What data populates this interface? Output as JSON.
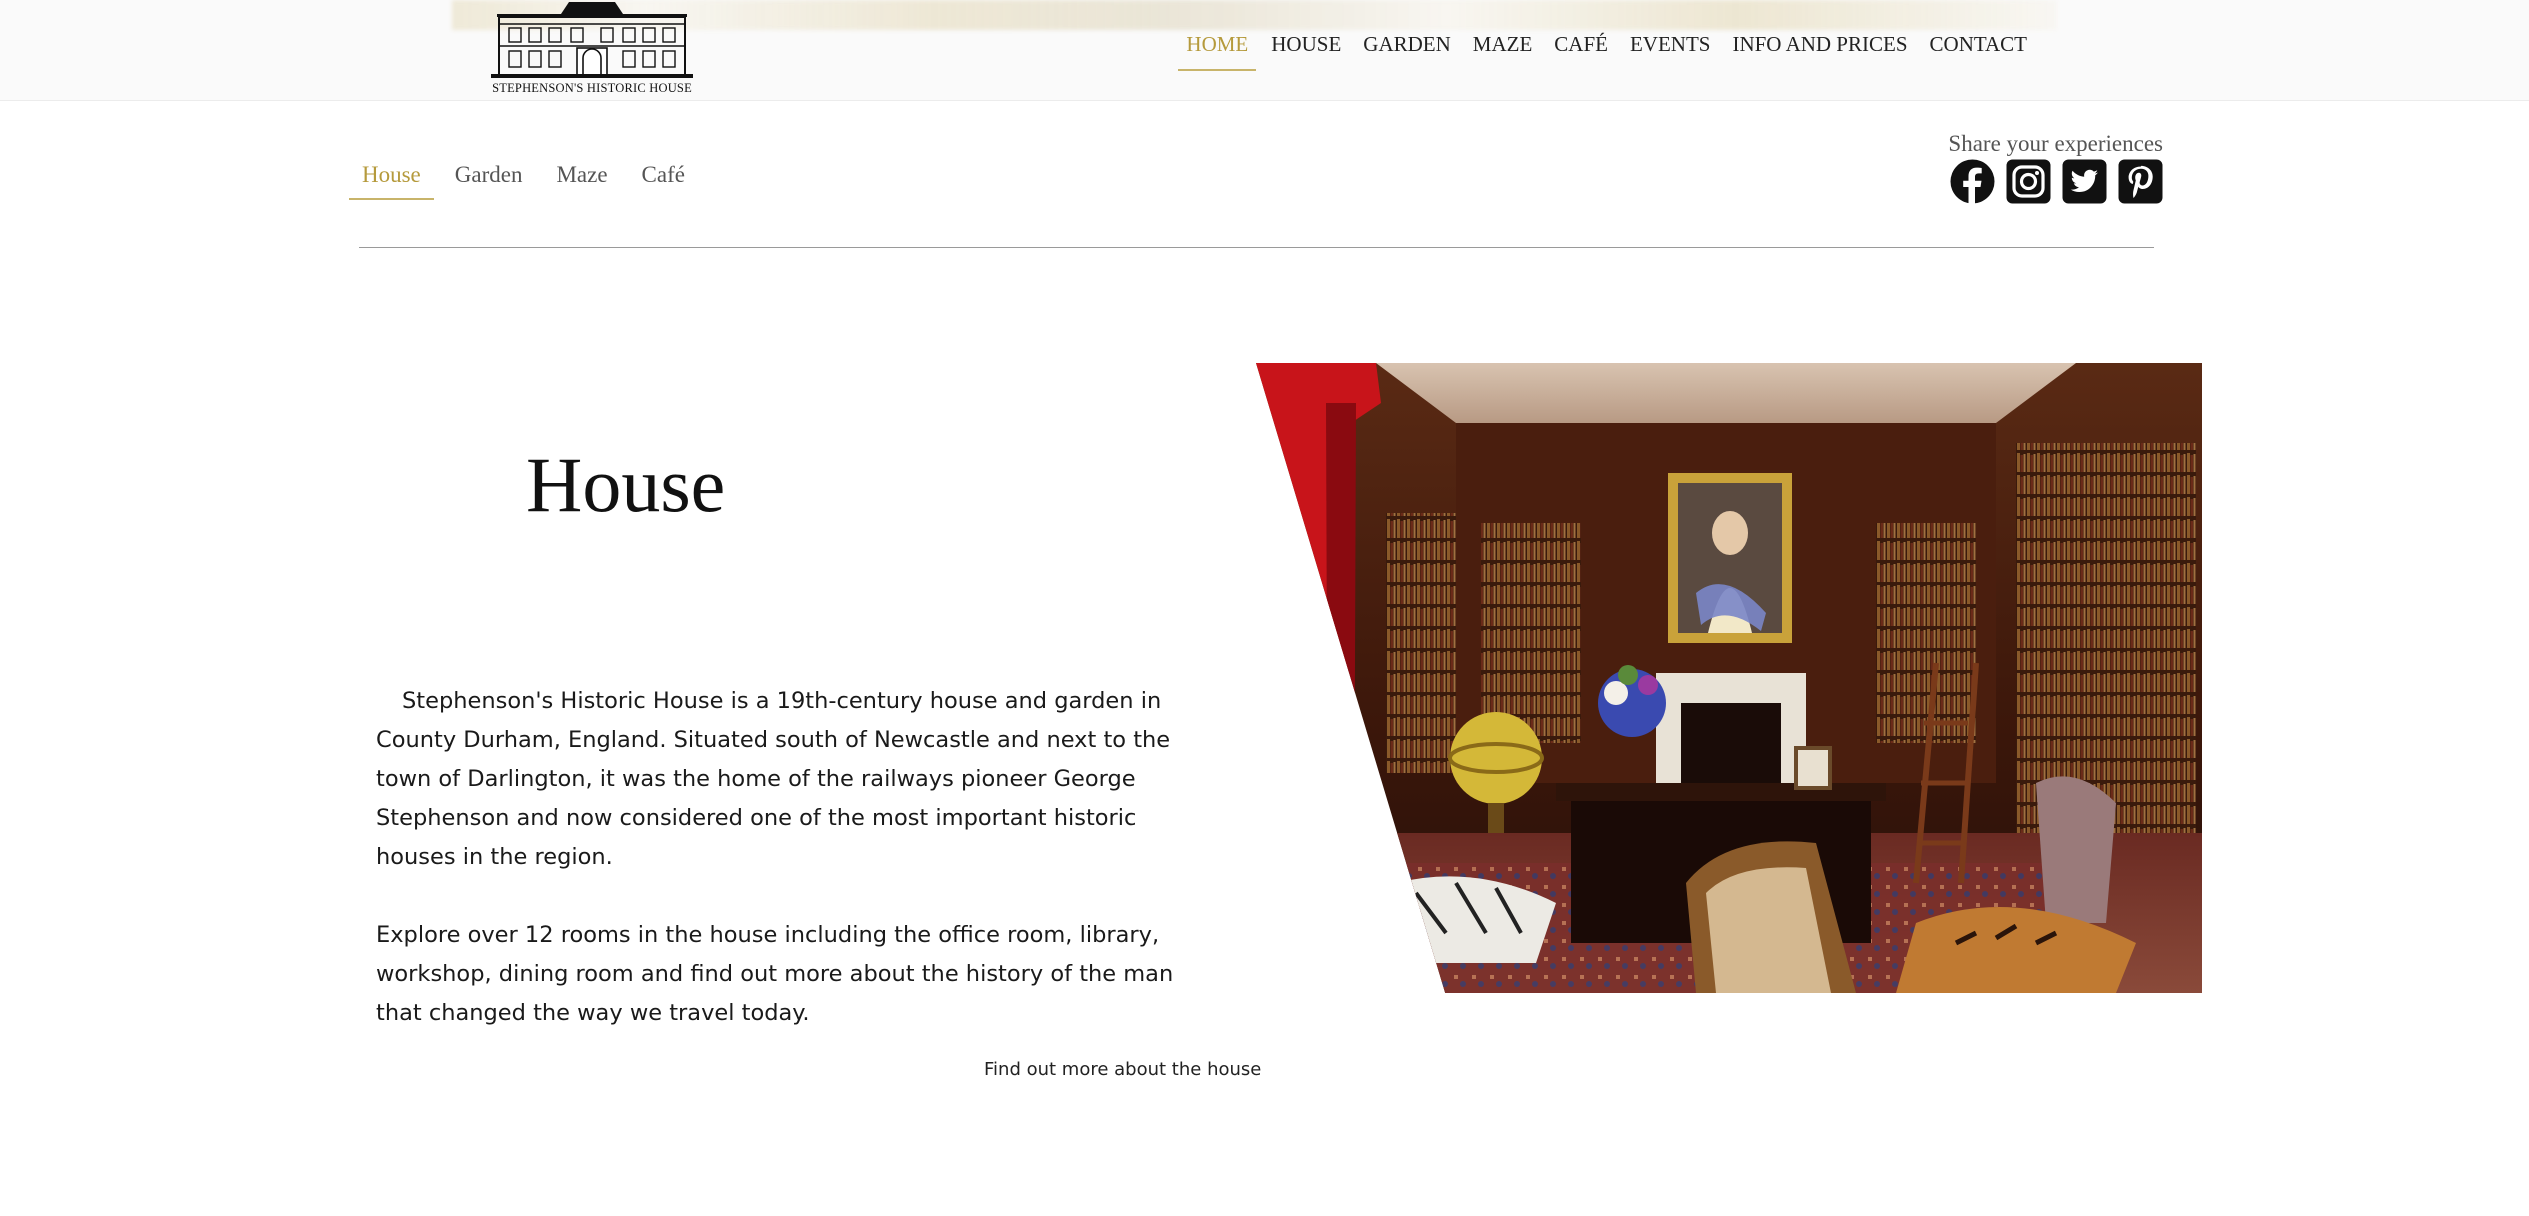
{
  "brand": {
    "logo_text": "STEPHENSON'S HISTORIC HOUSE"
  },
  "main_nav": {
    "items": [
      {
        "label": "HOME",
        "active": true
      },
      {
        "label": "HOUSE",
        "active": false
      },
      {
        "label": "GARDEN",
        "active": false
      },
      {
        "label": "MAZE",
        "active": false
      },
      {
        "label": "CAFÉ",
        "active": false
      },
      {
        "label": "EVENTS",
        "active": false
      },
      {
        "label": "INFO AND PRICES",
        "active": false
      },
      {
        "label": "CONTACT",
        "active": false
      }
    ]
  },
  "sub_nav": {
    "items": [
      {
        "label": "House",
        "active": true
      },
      {
        "label": "Garden",
        "active": false
      },
      {
        "label": "Maze",
        "active": false
      },
      {
        "label": "Café",
        "active": false
      }
    ]
  },
  "share": {
    "label": "Share your experiences",
    "icons": [
      "facebook-icon",
      "instagram-icon",
      "twitter-icon",
      "pinterest-icon"
    ]
  },
  "content": {
    "title": "House",
    "paragraphs": [
      "Stephenson's Historic House is a 19th-century house and garden in County Durham, England. Situated south of Newcastle and next to the town of Darlington, it was the home of the railways pioneer George Stephenson and now considered one of the most important historic houses in the region.",
      "Explore over 12 rooms in the house including the office room, library, workshop, dining room and find out more about the history of the man that changed the way we travel today."
    ],
    "image": "library-room-photo",
    "more_link": "Find out more about the house"
  },
  "colors": {
    "accent": "#b59a3c",
    "accent_line": "#c8b46a",
    "text": "#111111",
    "muted": "#555555",
    "divider": "#9a9a9a"
  }
}
